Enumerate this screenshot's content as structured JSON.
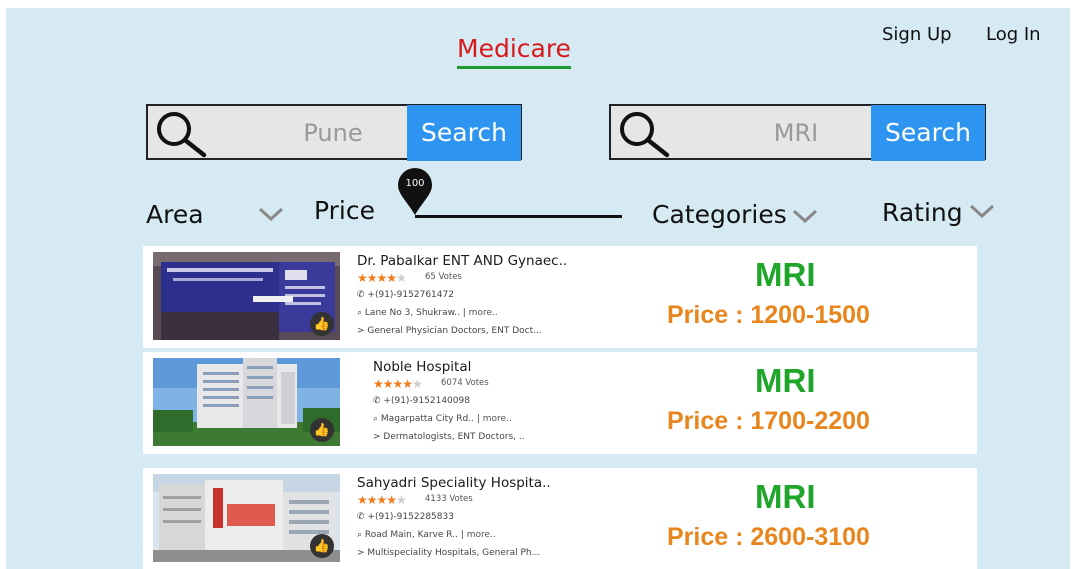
{
  "header": {
    "brand": "Medicare",
    "sign_up": "Sign Up",
    "log_in": "Log In"
  },
  "search_location": {
    "value": "Pune",
    "button": "Search"
  },
  "search_category": {
    "value": "MRI",
    "button": "Search"
  },
  "filters": {
    "area": "Area",
    "price": "Price",
    "price_value": "100",
    "categories": "Categories",
    "rating": "Rating"
  },
  "colors": {
    "background": "#d6eaf3",
    "brand": "#d8191b",
    "button": "#2d95f0",
    "tag": "#1ea52a",
    "price": "#e8861d",
    "stars": "#f07b1b"
  },
  "results": [
    {
      "name": "Dr. Pabalkar ENT AND Gynaec..",
      "rating_stars": 4,
      "votes": "65 Votes",
      "phone": "+(91)-9152761472",
      "address": "Lane No 3, Shukraw..",
      "more": "more..",
      "specialties": "General Physician Doctors, ENT Doct...",
      "tag": "MRI",
      "price": "Price : 1200-1500"
    },
    {
      "name": "Noble Hospital",
      "rating_stars": 4,
      "votes": "6074 Votes",
      "phone": "+(91)-9152140098",
      "address": "Magarpatta City Rd..",
      "more": "more..",
      "specialties": "Dermatologists, ENT Doctors, ..",
      "tag": "MRI",
      "price": "Price : 1700-2200"
    },
    {
      "name": "Sahyadri Speciality Hospita..",
      "rating_stars": 4,
      "votes": "4133 Votes",
      "phone": "+(91)-9152285833",
      "address": "Road Main, Karve R..",
      "more": "more..",
      "specialties": "Multispeciality Hospitals, General Ph...",
      "tag": "MRI",
      "price": "Price : 2600-3100"
    }
  ]
}
